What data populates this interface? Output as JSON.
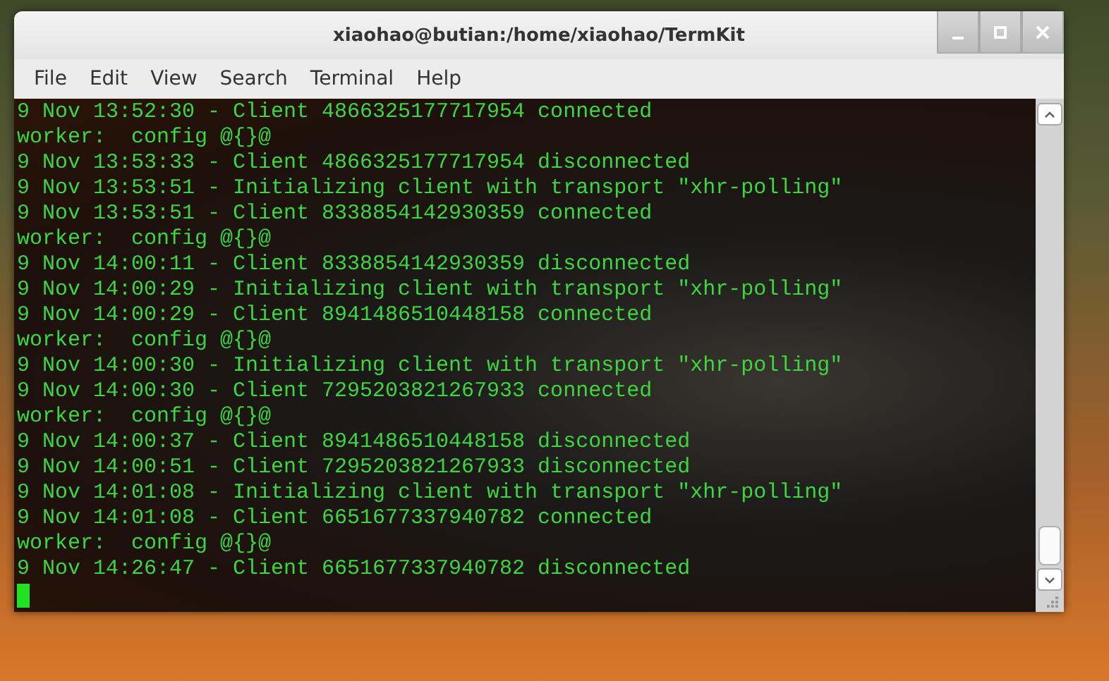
{
  "window": {
    "title": "xiaohao@butian:/home/xiaohao/TermKit"
  },
  "menu": [
    "File",
    "Edit",
    "View",
    "Search",
    "Terminal",
    "Help"
  ],
  "terminal": {
    "lines": [
      "9 Nov 13:52:30 - Client 4866325177717954 connected",
      "worker:  config @{}@",
      "9 Nov 13:53:33 - Client 4866325177717954 disconnected",
      "9 Nov 13:53:51 - Initializing client with transport \"xhr-polling\"",
      "9 Nov 13:53:51 - Client 8338854142930359 connected",
      "worker:  config @{}@",
      "9 Nov 14:00:11 - Client 8338854142930359 disconnected",
      "9 Nov 14:00:29 - Initializing client with transport \"xhr-polling\"",
      "9 Nov 14:00:29 - Client 8941486510448158 connected",
      "worker:  config @{}@",
      "9 Nov 14:00:30 - Initializing client with transport \"xhr-polling\"",
      "9 Nov 14:00:30 - Client 7295203821267933 connected",
      "worker:  config @{}@",
      "9 Nov 14:00:37 - Client 8941486510448158 disconnected",
      "9 Nov 14:00:51 - Client 7295203821267933 disconnected",
      "9 Nov 14:01:08 - Initializing client with transport \"xhr-polling\"",
      "9 Nov 14:01:08 - Client 6651677337940782 connected",
      "worker:  config @{}@",
      "9 Nov 14:26:47 - Client 6651677337940782 disconnected"
    ]
  }
}
